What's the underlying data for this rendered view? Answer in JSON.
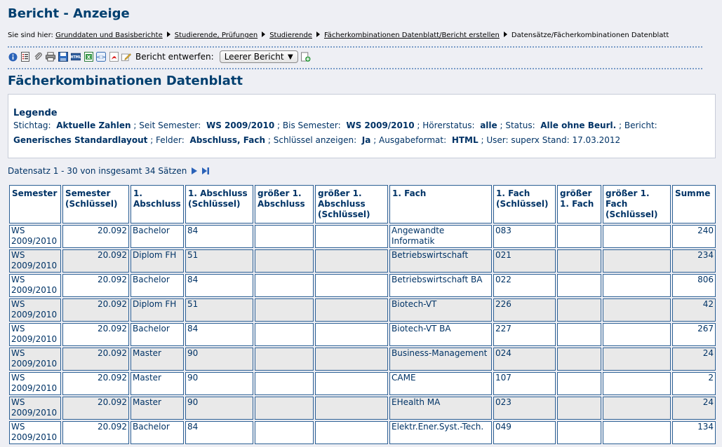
{
  "header": {
    "title": "Bericht - Anzeige"
  },
  "breadcrumb": {
    "prefix": "Sie sind hier:",
    "items": [
      "Grunddaten und Basisberichte",
      "Studierende, Prüfungen",
      "Studierende",
      "Fächerkombinationen Datenblatt/Bericht erstellen",
      "Datensätze/Fächerkombinationen Datenblatt"
    ]
  },
  "toolbar": {
    "icons": [
      "info-icon",
      "details-icon",
      "attach-icon",
      "print-icon",
      "save-icon",
      "html-export-icon",
      "excel-export-icon",
      "xml-export-icon",
      "pdf-export-icon",
      "edit-icon"
    ],
    "report_label": "Bericht entwerfen:",
    "report_select": "Leerer Bericht"
  },
  "main": {
    "title": "Fächerkombinationen Datenblatt"
  },
  "legend": {
    "title": "Legende",
    "stichtag_label": "Stichtag:",
    "stichtag": "Aktuelle Zahlen",
    "seit_label": "; Seit Semester:",
    "seit": "WS 2009/2010",
    "bis_label": "; Bis Semester:",
    "bis": "WS 2009/2010",
    "hoer_label": "; Hörerstatus:",
    "hoer": "alle",
    "status_label": "; Status:",
    "status": "Alle ohne Beurl.",
    "bericht_label": "; Bericht:",
    "bericht": "Generisches Standardlayout",
    "felder_label": "; Felder:",
    "felder": "Abschluss, Fach",
    "schluessel_label": "; Schlüssel anzeigen:",
    "schluessel": "Ja",
    "ausgabe_label": "; Ausgabeformat:",
    "ausgabe": "HTML",
    "rest": "; User: superx  Stand: 17.03.2012"
  },
  "records": {
    "info": "Datensatz 1 - 30 von insgesamt 34 Sätzen"
  },
  "table": {
    "columns": [
      "Semester",
      "Semester (Schlüssel)",
      "1. Abschluss",
      "1. Abschluss (Schlüssel)",
      "größer 1. Abschluss",
      "größer 1. Abschluss (Schlüssel)",
      "1. Fach",
      "1. Fach (Schlüssel)",
      "größer 1. Fach",
      "größer 1. Fach (Schlüssel)",
      "Summe"
    ],
    "rows": [
      {
        "semester": "WS 2009/2010",
        "sem_key": "20.092",
        "abschluss": "Bachelor",
        "abschluss_key": "84",
        "g_abschluss": "",
        "g_abschluss_key": "",
        "fach": "Angewandte Informatik",
        "fach_key": "083",
        "g_fach": "",
        "g_fach_key": "",
        "summe": "240"
      },
      {
        "semester": "WS 2009/2010",
        "sem_key": "20.092",
        "abschluss": "Diplom FH",
        "abschluss_key": "51",
        "g_abschluss": "",
        "g_abschluss_key": "",
        "fach": "Betriebswirtschaft",
        "fach_key": "021",
        "g_fach": "",
        "g_fach_key": "",
        "summe": "234"
      },
      {
        "semester": "WS 2009/2010",
        "sem_key": "20.092",
        "abschluss": "Bachelor",
        "abschluss_key": "84",
        "g_abschluss": "",
        "g_abschluss_key": "",
        "fach": "Betriebswirtschaft BA",
        "fach_key": "022",
        "g_fach": "",
        "g_fach_key": "",
        "summe": "806"
      },
      {
        "semester": "WS 2009/2010",
        "sem_key": "20.092",
        "abschluss": "Diplom FH",
        "abschluss_key": "51",
        "g_abschluss": "",
        "g_abschluss_key": "",
        "fach": "Biotech-VT",
        "fach_key": "226",
        "g_fach": "",
        "g_fach_key": "",
        "summe": "42"
      },
      {
        "semester": "WS 2009/2010",
        "sem_key": "20.092",
        "abschluss": "Bachelor",
        "abschluss_key": "84",
        "g_abschluss": "",
        "g_abschluss_key": "",
        "fach": "Biotech-VT BA",
        "fach_key": "227",
        "g_fach": "",
        "g_fach_key": "",
        "summe": "267"
      },
      {
        "semester": "WS 2009/2010",
        "sem_key": "20.092",
        "abschluss": "Master",
        "abschluss_key": "90",
        "g_abschluss": "",
        "g_abschluss_key": "",
        "fach": "Business-Management",
        "fach_key": "024",
        "g_fach": "",
        "g_fach_key": "",
        "summe": "24"
      },
      {
        "semester": "WS 2009/2010",
        "sem_key": "20.092",
        "abschluss": "Master",
        "abschluss_key": "90",
        "g_abschluss": "",
        "g_abschluss_key": "",
        "fach": "CAME",
        "fach_key": "107",
        "g_fach": "",
        "g_fach_key": "",
        "summe": "2"
      },
      {
        "semester": "WS 2009/2010",
        "sem_key": "20.092",
        "abschluss": "Master",
        "abschluss_key": "90",
        "g_abschluss": "",
        "g_abschluss_key": "",
        "fach": "EHealth MA",
        "fach_key": "023",
        "g_fach": "",
        "g_fach_key": "",
        "summe": "24"
      },
      {
        "semester": "WS 2009/2010",
        "sem_key": "20.092",
        "abschluss": "Bachelor",
        "abschluss_key": "84",
        "g_abschluss": "",
        "g_abschluss_key": "",
        "fach": "Elektr.Ener.Syst.-Tech.",
        "fach_key": "049",
        "g_fach": "",
        "g_fach_key": "",
        "summe": "134"
      }
    ]
  }
}
